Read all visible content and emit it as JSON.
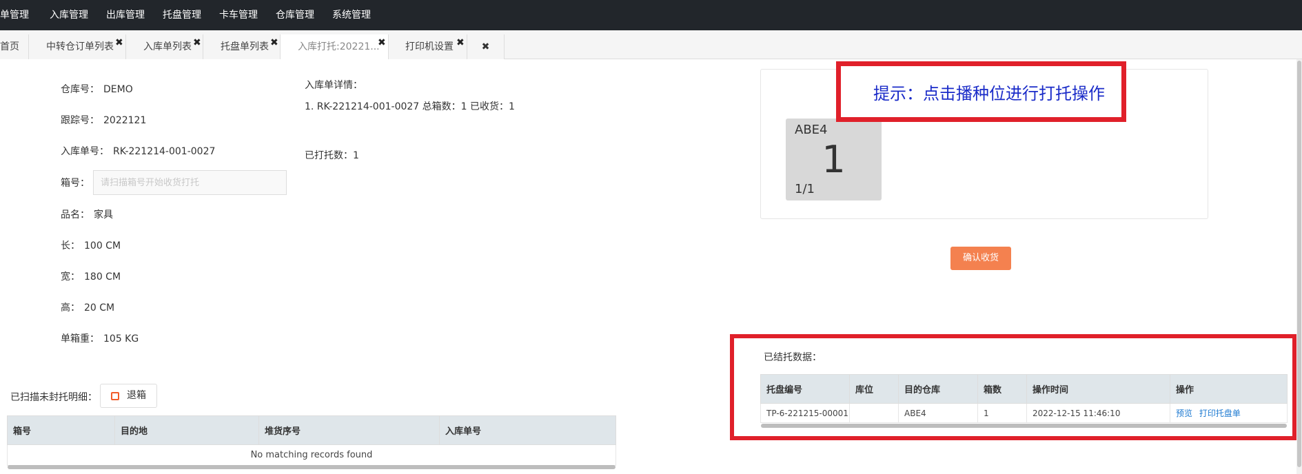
{
  "nav": {
    "items": [
      "单管理",
      "入库管理",
      "出库管理",
      "托盘管理",
      "卡车管理",
      "仓库管理",
      "系统管理"
    ]
  },
  "tabs": [
    {
      "label": "首页",
      "closable": false,
      "active": false
    },
    {
      "label": "中转仓订单列表",
      "closable": true,
      "active": false
    },
    {
      "label": "入库单列表",
      "closable": true,
      "active": false
    },
    {
      "label": "托盘单列表",
      "closable": true,
      "active": false
    },
    {
      "label": "入库打托:20221...",
      "closable": true,
      "active": true
    },
    {
      "label": "打印机设置",
      "closable": true,
      "active": false
    }
  ],
  "close_all_glyph": "✖",
  "tab_close_glyph": "✖",
  "form": {
    "warehouse_label": "仓库号：",
    "warehouse_value": "DEMO",
    "tracking_label": "跟踪号：",
    "tracking_value": "2022121",
    "inbound_label": "入库单号：",
    "inbound_value": "RK-221214-001-0027",
    "box_label": "箱号：",
    "box_placeholder": "请扫描箱号开始收货打托",
    "product_label": "品名：",
    "product_value": "家具",
    "length_label": "长：",
    "length_value": "100 CM",
    "width_label": "宽：",
    "width_value": "180 CM",
    "height_label": "高：",
    "height_value": "20 CM",
    "weight_label": "单箱重：",
    "weight_value": "105 KG"
  },
  "details": {
    "title": "入库单详情：",
    "line": "1. RK-221214-001-0027    总箱数：1    已收货：1",
    "pallet_count": "已打托数：1"
  },
  "slot": {
    "code": "ABE4",
    "count": "1",
    "fraction": "1/1"
  },
  "hint": "提示：点击播种位进行打托操作",
  "confirm_label": "确认收货",
  "pallet_section": {
    "title": "已结托数据：",
    "headers": [
      "托盘编号",
      "库位",
      "目的仓库",
      "箱数",
      "操作时间",
      "操作"
    ],
    "rows": [
      {
        "id": "TP-6-221215-00001",
        "location": "",
        "dest": "ABE4",
        "boxes": "1",
        "time": "2022-12-15 11:46:10",
        "action_preview": "预览",
        "action_print": "打印托盘单"
      }
    ]
  },
  "scanned_section": {
    "title": "已扫描未封托明细：",
    "return_label": "退箱",
    "headers": [
      "箱号",
      "目的地",
      "堆货序号",
      "入库单号"
    ],
    "empty": "No matching records found"
  },
  "colors": {
    "nav_bg": "#22262b",
    "highlight_border": "#e0202a",
    "hint_text": "#1a2bc8",
    "confirm_button": "#f4814f",
    "link": "#1e7ad1",
    "table_header": "#dfe6ea",
    "slot_card": "#d8d8d8"
  },
  "icons": {
    "return": "trash-icon",
    "close": "close-icon"
  }
}
